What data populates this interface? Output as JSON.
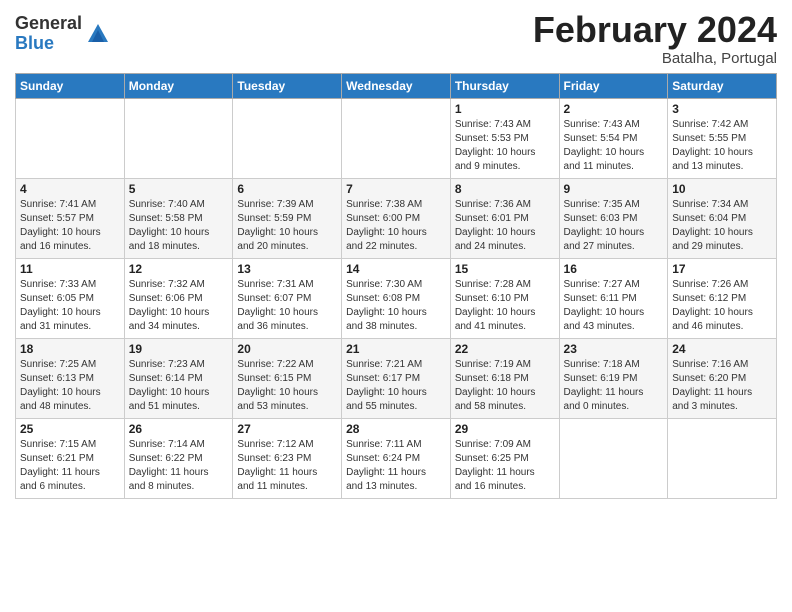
{
  "header": {
    "logo_general": "General",
    "logo_blue": "Blue",
    "month_title": "February 2024",
    "subtitle": "Batalha, Portugal"
  },
  "weekdays": [
    "Sunday",
    "Monday",
    "Tuesday",
    "Wednesday",
    "Thursday",
    "Friday",
    "Saturday"
  ],
  "weeks": [
    [
      {
        "day": "",
        "info": ""
      },
      {
        "day": "",
        "info": ""
      },
      {
        "day": "",
        "info": ""
      },
      {
        "day": "",
        "info": ""
      },
      {
        "day": "1",
        "info": "Sunrise: 7:43 AM\nSunset: 5:53 PM\nDaylight: 10 hours\nand 9 minutes."
      },
      {
        "day": "2",
        "info": "Sunrise: 7:43 AM\nSunset: 5:54 PM\nDaylight: 10 hours\nand 11 minutes."
      },
      {
        "day": "3",
        "info": "Sunrise: 7:42 AM\nSunset: 5:55 PM\nDaylight: 10 hours\nand 13 minutes."
      }
    ],
    [
      {
        "day": "4",
        "info": "Sunrise: 7:41 AM\nSunset: 5:57 PM\nDaylight: 10 hours\nand 16 minutes."
      },
      {
        "day": "5",
        "info": "Sunrise: 7:40 AM\nSunset: 5:58 PM\nDaylight: 10 hours\nand 18 minutes."
      },
      {
        "day": "6",
        "info": "Sunrise: 7:39 AM\nSunset: 5:59 PM\nDaylight: 10 hours\nand 20 minutes."
      },
      {
        "day": "7",
        "info": "Sunrise: 7:38 AM\nSunset: 6:00 PM\nDaylight: 10 hours\nand 22 minutes."
      },
      {
        "day": "8",
        "info": "Sunrise: 7:36 AM\nSunset: 6:01 PM\nDaylight: 10 hours\nand 24 minutes."
      },
      {
        "day": "9",
        "info": "Sunrise: 7:35 AM\nSunset: 6:03 PM\nDaylight: 10 hours\nand 27 minutes."
      },
      {
        "day": "10",
        "info": "Sunrise: 7:34 AM\nSunset: 6:04 PM\nDaylight: 10 hours\nand 29 minutes."
      }
    ],
    [
      {
        "day": "11",
        "info": "Sunrise: 7:33 AM\nSunset: 6:05 PM\nDaylight: 10 hours\nand 31 minutes."
      },
      {
        "day": "12",
        "info": "Sunrise: 7:32 AM\nSunset: 6:06 PM\nDaylight: 10 hours\nand 34 minutes."
      },
      {
        "day": "13",
        "info": "Sunrise: 7:31 AM\nSunset: 6:07 PM\nDaylight: 10 hours\nand 36 minutes."
      },
      {
        "day": "14",
        "info": "Sunrise: 7:30 AM\nSunset: 6:08 PM\nDaylight: 10 hours\nand 38 minutes."
      },
      {
        "day": "15",
        "info": "Sunrise: 7:28 AM\nSunset: 6:10 PM\nDaylight: 10 hours\nand 41 minutes."
      },
      {
        "day": "16",
        "info": "Sunrise: 7:27 AM\nSunset: 6:11 PM\nDaylight: 10 hours\nand 43 minutes."
      },
      {
        "day": "17",
        "info": "Sunrise: 7:26 AM\nSunset: 6:12 PM\nDaylight: 10 hours\nand 46 minutes."
      }
    ],
    [
      {
        "day": "18",
        "info": "Sunrise: 7:25 AM\nSunset: 6:13 PM\nDaylight: 10 hours\nand 48 minutes."
      },
      {
        "day": "19",
        "info": "Sunrise: 7:23 AM\nSunset: 6:14 PM\nDaylight: 10 hours\nand 51 minutes."
      },
      {
        "day": "20",
        "info": "Sunrise: 7:22 AM\nSunset: 6:15 PM\nDaylight: 10 hours\nand 53 minutes."
      },
      {
        "day": "21",
        "info": "Sunrise: 7:21 AM\nSunset: 6:17 PM\nDaylight: 10 hours\nand 55 minutes."
      },
      {
        "day": "22",
        "info": "Sunrise: 7:19 AM\nSunset: 6:18 PM\nDaylight: 10 hours\nand 58 minutes."
      },
      {
        "day": "23",
        "info": "Sunrise: 7:18 AM\nSunset: 6:19 PM\nDaylight: 11 hours\nand 0 minutes."
      },
      {
        "day": "24",
        "info": "Sunrise: 7:16 AM\nSunset: 6:20 PM\nDaylight: 11 hours\nand 3 minutes."
      }
    ],
    [
      {
        "day": "25",
        "info": "Sunrise: 7:15 AM\nSunset: 6:21 PM\nDaylight: 11 hours\nand 6 minutes."
      },
      {
        "day": "26",
        "info": "Sunrise: 7:14 AM\nSunset: 6:22 PM\nDaylight: 11 hours\nand 8 minutes."
      },
      {
        "day": "27",
        "info": "Sunrise: 7:12 AM\nSunset: 6:23 PM\nDaylight: 11 hours\nand 11 minutes."
      },
      {
        "day": "28",
        "info": "Sunrise: 7:11 AM\nSunset: 6:24 PM\nDaylight: 11 hours\nand 13 minutes."
      },
      {
        "day": "29",
        "info": "Sunrise: 7:09 AM\nSunset: 6:25 PM\nDaylight: 11 hours\nand 16 minutes."
      },
      {
        "day": "",
        "info": ""
      },
      {
        "day": "",
        "info": ""
      }
    ]
  ]
}
